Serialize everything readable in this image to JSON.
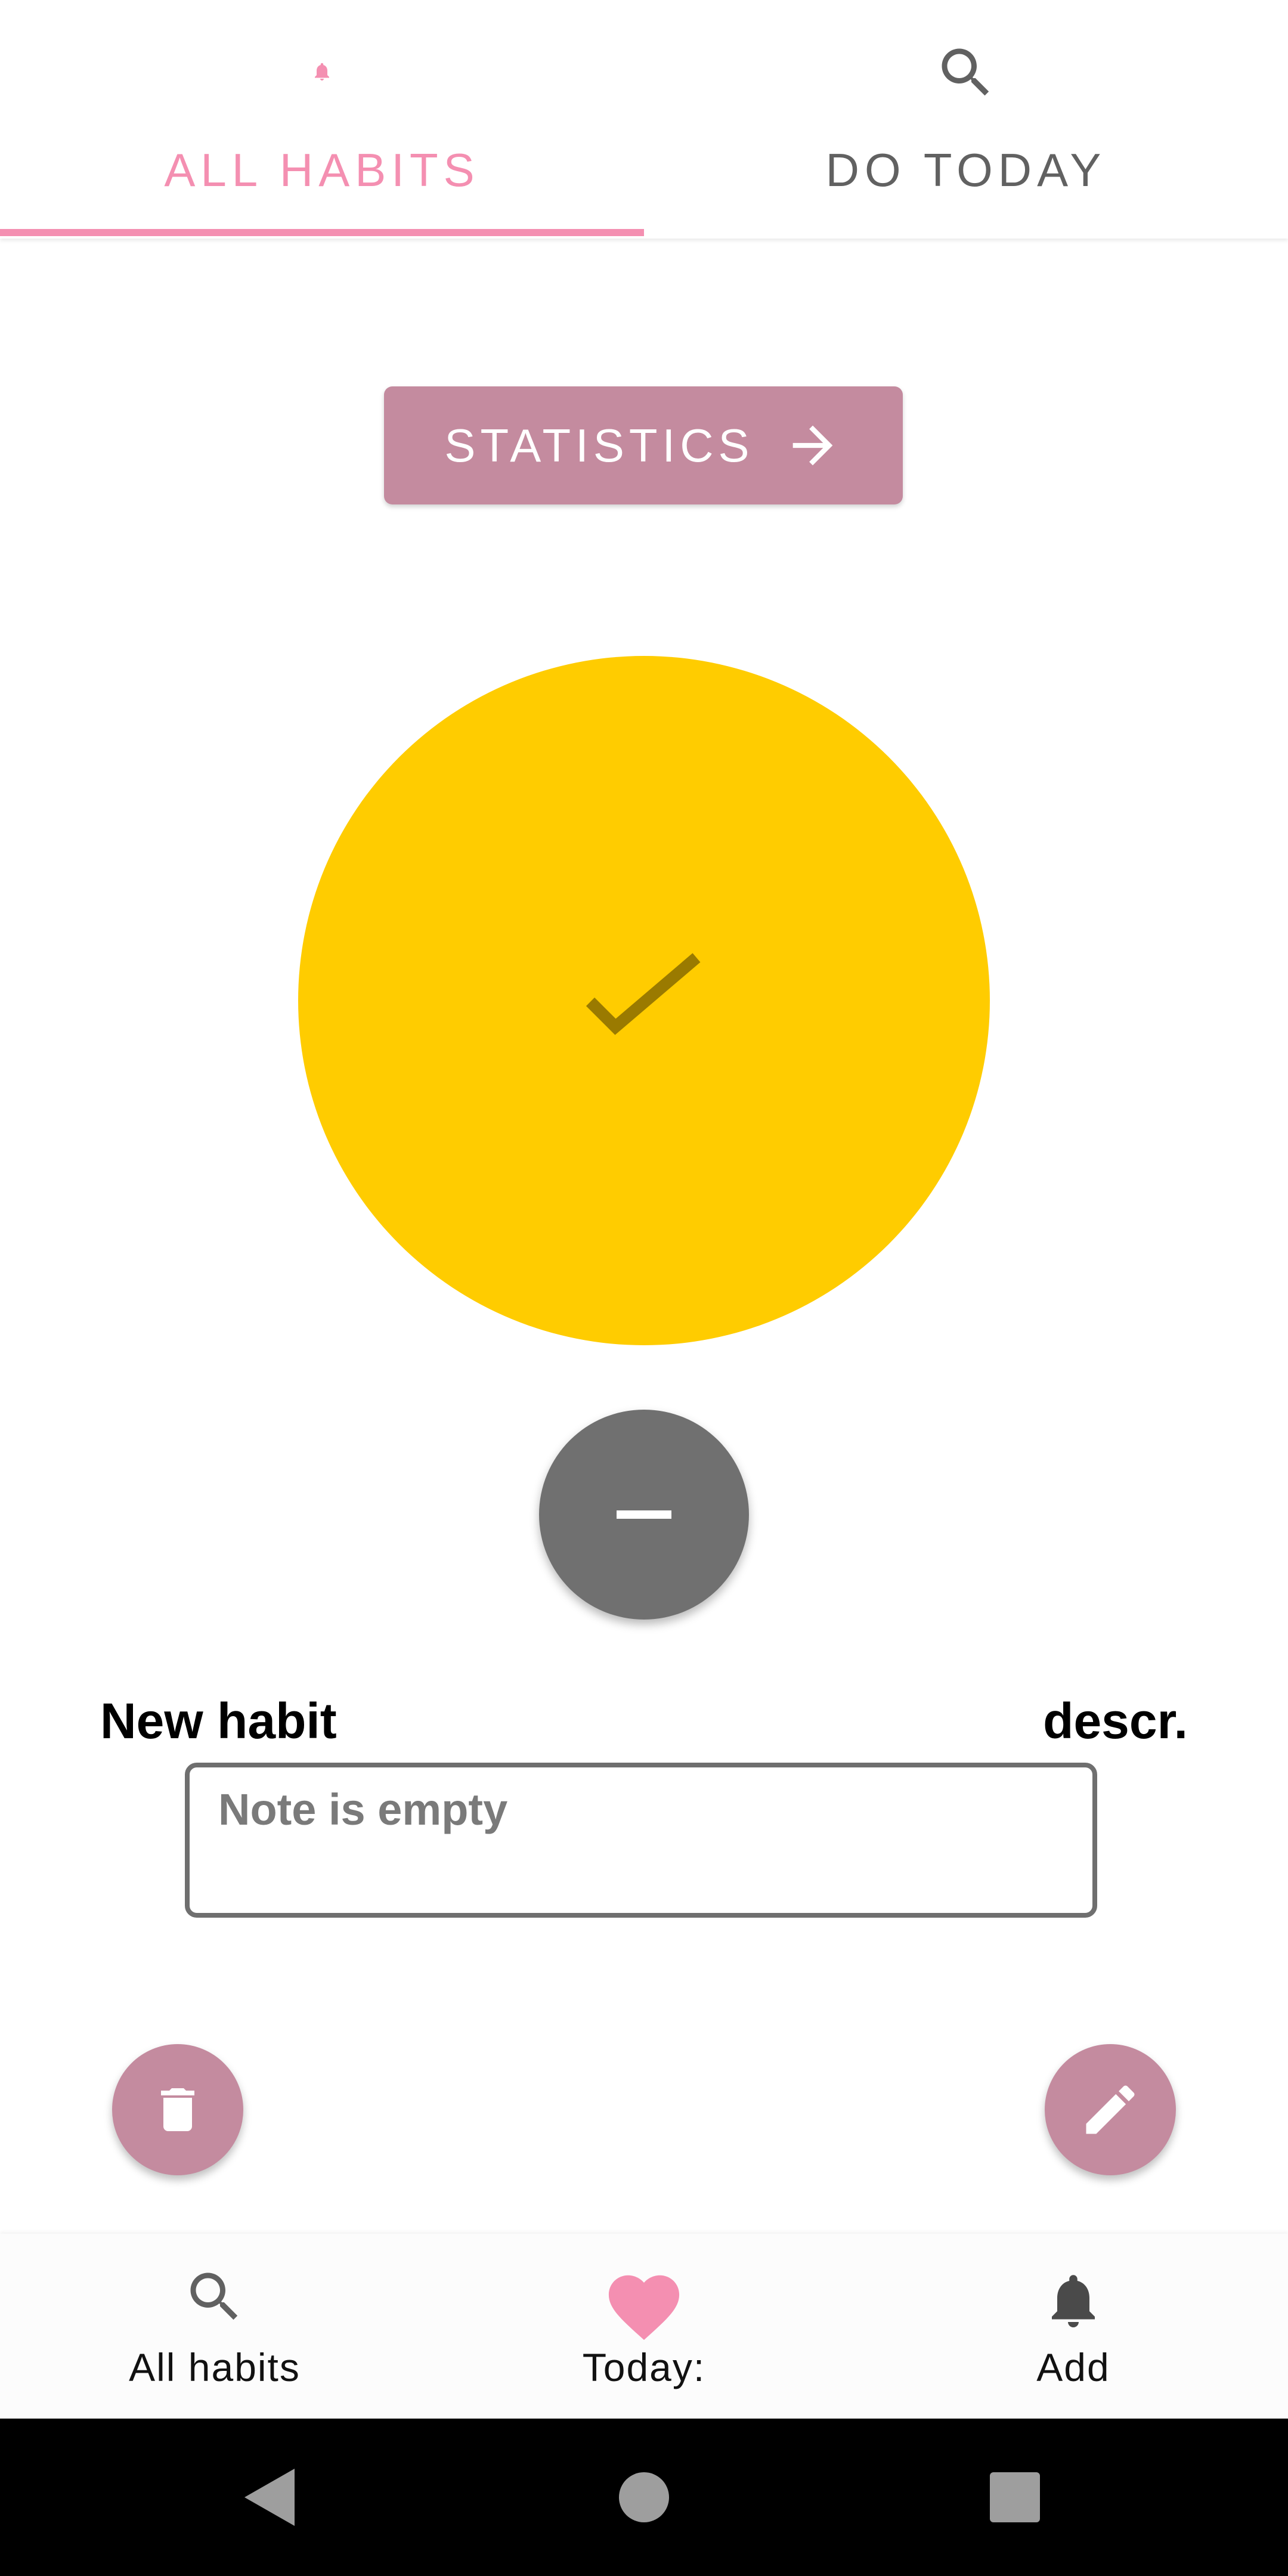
{
  "tabs": [
    {
      "label": "ALL HABITS",
      "icon": "bell-icon",
      "selected": true
    },
    {
      "label": "DO TODAY",
      "icon": "search-icon",
      "selected": false
    }
  ],
  "statistics_button": {
    "label": "STATISTICS",
    "icon": "arrow-right-icon"
  },
  "habit": {
    "name": "New habit",
    "description": "descr.",
    "note_placeholder": "Note is empty",
    "done": true
  },
  "bottom_nav": [
    {
      "label": "All habits",
      "icon": "search-icon"
    },
    {
      "label": "Today:",
      "icon": "heart-icon"
    },
    {
      "label": "Add",
      "icon": "bell-icon"
    }
  ],
  "colors": {
    "accent": "#f48fb1",
    "button": "#c48b9f",
    "circle": "#ffcc00",
    "fab_dark": "#707070"
  }
}
